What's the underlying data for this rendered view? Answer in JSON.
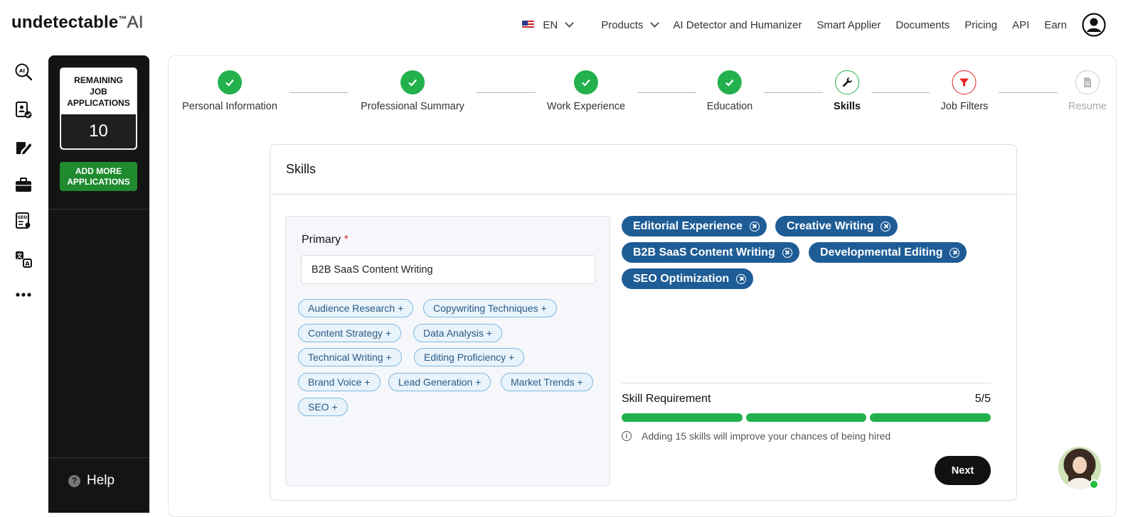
{
  "brand": {
    "name": "undetectable",
    "tm": "™",
    "suffix": "AI"
  },
  "nav": {
    "language": "EN",
    "items": [
      "Products",
      "AI Detector and Humanizer",
      "Smart Applier",
      "Documents",
      "Pricing",
      "API",
      "Earn"
    ]
  },
  "rail": {
    "icons": [
      "ai-search-icon",
      "resume-check-icon",
      "edit-document-icon",
      "briefcase-icon",
      "seo-document-icon",
      "translate-icon",
      "more-icon"
    ]
  },
  "panel": {
    "remaining_label": "REMAINING JOB APPLICATIONS",
    "remaining_count": "10",
    "add_more_label": "ADD MORE APPLICATIONS",
    "help_label": "Help",
    "help_glyph": "?"
  },
  "steps": [
    {
      "label": "Personal Information",
      "state": "done"
    },
    {
      "label": "Professional Summary",
      "state": "done"
    },
    {
      "label": "Work Experience",
      "state": "done"
    },
    {
      "label": "Education",
      "state": "done"
    },
    {
      "label": "Skills",
      "state": "current"
    },
    {
      "label": "Job Filters",
      "state": "filter"
    },
    {
      "label": "Resume",
      "state": "todo"
    }
  ],
  "skills": {
    "title": "Skills",
    "primary_label": "Primary",
    "required_mark": "*",
    "primary_value": "B2B SaaS Content Writing",
    "suggestions": [
      "Audience Research +",
      "Copywriting Techniques +",
      "Content Strategy +",
      "Data Analysis +",
      "Technical Writing +",
      "Editing Proficiency +",
      "Brand Voice +",
      "Lead Generation +",
      "Market Trends +",
      "SEO +"
    ],
    "selected": [
      "Editorial Experience",
      "Creative Writing",
      "B2B SaaS Content Writing",
      "Developmental Editing",
      "SEO Optimization"
    ],
    "requirement_label": "Skill Requirement",
    "requirement_count": "5/5",
    "requirement_progress": 1.0,
    "hint_glyph": "i",
    "hint": "Adding 15 skills will improve your chances of being hired",
    "next_label": "Next"
  },
  "colors": {
    "success": "#22b14c",
    "chip_selected": "#1e5c96",
    "add_button": "#1f8a2e",
    "panel_bg": "#141414"
  }
}
